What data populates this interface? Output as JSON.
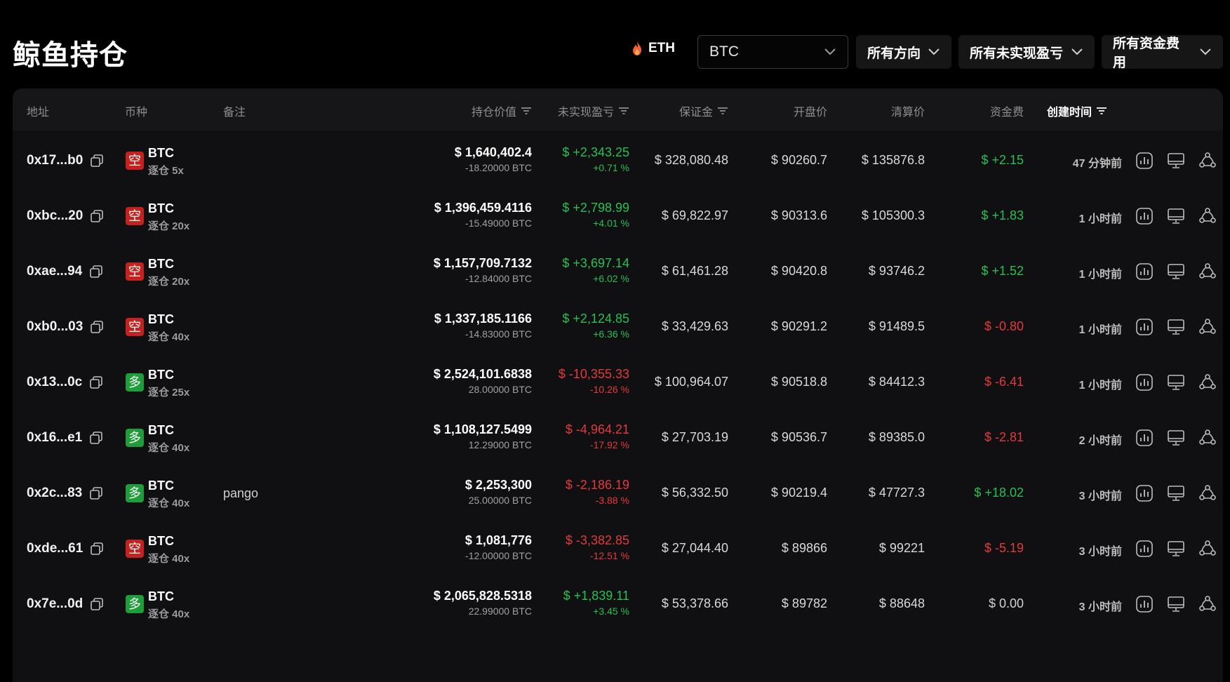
{
  "header": {
    "title": "鲸鱼持仓",
    "eth_label": "ETH",
    "coin_select": "BTC",
    "direction_select": "所有方向",
    "pnl_select": "所有未实现盈亏",
    "funding_select": "所有资金费用"
  },
  "columns": {
    "address": "地址",
    "coin": "币种",
    "note": "备注",
    "value": "持仓价值",
    "pnl": "未实现盈亏",
    "margin": "保证金",
    "entry": "开盘价",
    "liq": "清算价",
    "funding": "资金费",
    "created": "创建时间"
  },
  "colors": {
    "positive": "#27c052",
    "negative": "#e33a3a",
    "short_badge": "#c5221f",
    "long_badge": "#1f9d3a"
  },
  "rows": [
    {
      "address": "0x17...b0",
      "side": "空",
      "side_type": "short",
      "coin": "BTC",
      "leverage": "逐仓 5x",
      "note": "",
      "value": "$ 1,640,402.4",
      "size": "-18.20000 BTC",
      "pnl": "$ +2,343.25",
      "pnl_pct": "+0.71 %",
      "pnl_type": "pos",
      "margin": "$ 328,080.48",
      "entry": "$ 90260.7",
      "liq": "$ 135876.8",
      "fee": "$ +2.15",
      "fee_type": "pos",
      "time": "47 分钟前"
    },
    {
      "address": "0xbc...20",
      "side": "空",
      "side_type": "short",
      "coin": "BTC",
      "leverage": "逐仓 20x",
      "note": "",
      "value": "$ 1,396,459.4116",
      "size": "-15.49000 BTC",
      "pnl": "$ +2,798.99",
      "pnl_pct": "+4.01 %",
      "pnl_type": "pos",
      "margin": "$ 69,822.97",
      "entry": "$ 90313.6",
      "liq": "$ 105300.3",
      "fee": "$ +1.83",
      "fee_type": "pos",
      "time": "1 小时前"
    },
    {
      "address": "0xae...94",
      "side": "空",
      "side_type": "short",
      "coin": "BTC",
      "leverage": "逐仓 20x",
      "note": "",
      "value": "$ 1,157,709.7132",
      "size": "-12.84000 BTC",
      "pnl": "$ +3,697.14",
      "pnl_pct": "+6.02 %",
      "pnl_type": "pos",
      "margin": "$ 61,461.28",
      "entry": "$ 90420.8",
      "liq": "$ 93746.2",
      "fee": "$ +1.52",
      "fee_type": "pos",
      "time": "1 小时前"
    },
    {
      "address": "0xb0...03",
      "side": "空",
      "side_type": "short",
      "coin": "BTC",
      "leverage": "逐仓 40x",
      "note": "",
      "value": "$ 1,337,185.1166",
      "size": "-14.83000 BTC",
      "pnl": "$ +2,124.85",
      "pnl_pct": "+6.36 %",
      "pnl_type": "pos",
      "margin": "$ 33,429.63",
      "entry": "$ 90291.2",
      "liq": "$ 91489.5",
      "fee": "$ -0.80",
      "fee_type": "neg",
      "time": "1 小时前"
    },
    {
      "address": "0x13...0c",
      "side": "多",
      "side_type": "long",
      "coin": "BTC",
      "leverage": "逐仓 25x",
      "note": "",
      "value": "$ 2,524,101.6838",
      "size": "28.00000 BTC",
      "pnl": "$ -10,355.33",
      "pnl_pct": "-10.26 %",
      "pnl_type": "neg",
      "margin": "$ 100,964.07",
      "entry": "$ 90518.8",
      "liq": "$ 84412.3",
      "fee": "$ -6.41",
      "fee_type": "neg",
      "time": "1 小时前"
    },
    {
      "address": "0x16...e1",
      "side": "多",
      "side_type": "long",
      "coin": "BTC",
      "leverage": "逐仓 40x",
      "note": "",
      "value": "$ 1,108,127.5499",
      "size": "12.29000 BTC",
      "pnl": "$ -4,964.21",
      "pnl_pct": "-17.92 %",
      "pnl_type": "neg",
      "margin": "$ 27,703.19",
      "entry": "$ 90536.7",
      "liq": "$ 89385.0",
      "fee": "$ -2.81",
      "fee_type": "neg",
      "time": "2 小时前"
    },
    {
      "address": "0x2c...83",
      "side": "多",
      "side_type": "long",
      "coin": "BTC",
      "leverage": "逐仓 40x",
      "note": "pango",
      "value": "$ 2,253,300",
      "size": "25.00000 BTC",
      "pnl": "$ -2,186.19",
      "pnl_pct": "-3.88 %",
      "pnl_type": "neg",
      "margin": "$ 56,332.50",
      "entry": "$ 90219.4",
      "liq": "$ 47727.3",
      "fee": "$ +18.02",
      "fee_type": "pos",
      "time": "3 小时前"
    },
    {
      "address": "0xde...61",
      "side": "空",
      "side_type": "short",
      "coin": "BTC",
      "leverage": "逐仓 40x",
      "note": "",
      "value": "$ 1,081,776",
      "size": "-12.00000 BTC",
      "pnl": "$ -3,382.85",
      "pnl_pct": "-12.51 %",
      "pnl_type": "neg",
      "margin": "$ 27,044.40",
      "entry": "$ 89866",
      "liq": "$ 99221",
      "fee": "$ -5.19",
      "fee_type": "neg",
      "time": "3 小时前"
    },
    {
      "address": "0x7e...0d",
      "side": "多",
      "side_type": "long",
      "coin": "BTC",
      "leverage": "逐仓 40x",
      "note": "",
      "value": "$ 2,065,828.5318",
      "size": "22.99000 BTC",
      "pnl": "$ +1,839.11",
      "pnl_pct": "+3.45 %",
      "pnl_type": "pos",
      "margin": "$ 53,378.66",
      "entry": "$ 89782",
      "liq": "$ 88648",
      "fee": "$ 0.00",
      "fee_type": "zero",
      "time": "3 小时前"
    }
  ]
}
